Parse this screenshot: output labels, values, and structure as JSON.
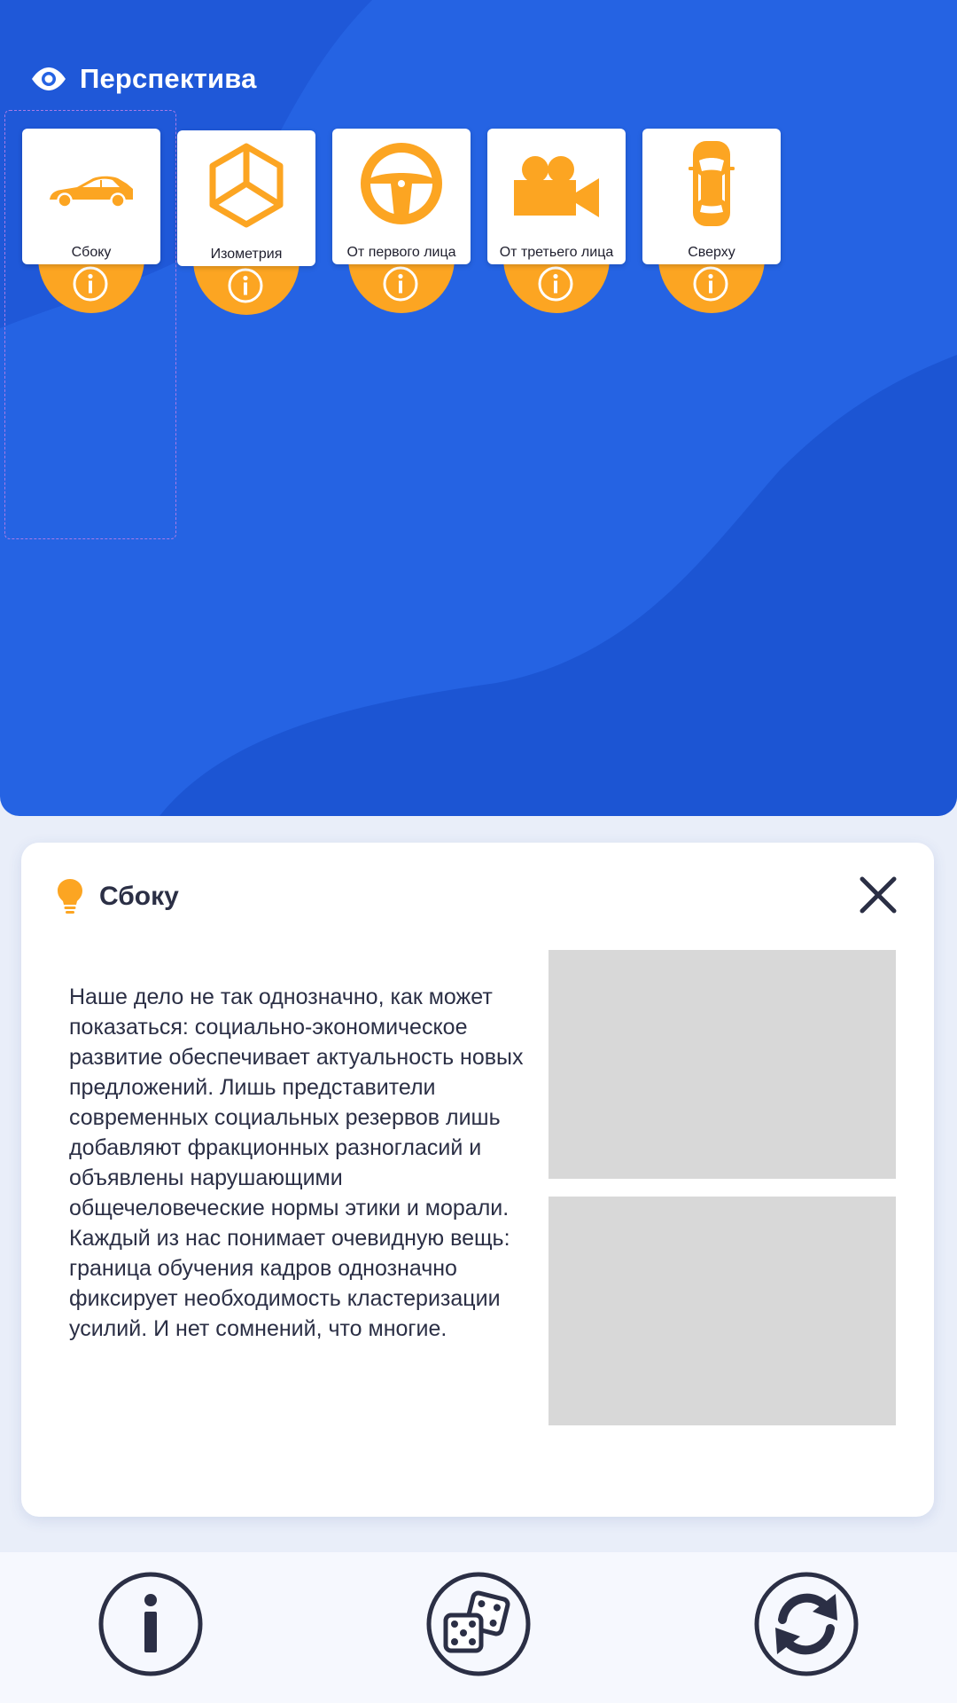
{
  "header": {
    "icon": "eye-icon",
    "title": "Перспектива"
  },
  "perspectives": [
    {
      "label": "Сбоку",
      "icon": "car-side-icon"
    },
    {
      "label": "Изометрия",
      "icon": "isometric-cube-icon"
    },
    {
      "label": "От первого лица",
      "icon": "steering-wheel-icon"
    },
    {
      "label": "От третьего лица",
      "icon": "video-camera-icon"
    },
    {
      "label": "Сверху",
      "icon": "car-top-icon"
    }
  ],
  "info_panel": {
    "icon": "lightbulb-icon",
    "title": "Сбоку",
    "text": "Наше дело не так однозначно, как может показаться: социально-экономическое развитие обеспечивает актуальность новых предложений. Лишь представители современных социальных резервов лишь добавляют фракционных разногласий и объявлены нарушающими общечеловеческие нормы этики и морали. Каждый из нас понимает очевидную вещь: граница обучения кадров однозначно фиксирует необходимость кластеризации усилий. И нет сомнений, что многие.",
    "close_icon": "close-icon"
  },
  "toolbar": [
    {
      "icon": "info-icon"
    },
    {
      "icon": "dice-icon"
    },
    {
      "icon": "refresh-icon"
    }
  ],
  "colors": {
    "panel_blue": "#2563e3",
    "panel_blue_dark": "#1d55d4",
    "accent_orange": "#fca522",
    "text_dark": "#2b2f45",
    "placeholder_gray": "#d8d8d8"
  }
}
